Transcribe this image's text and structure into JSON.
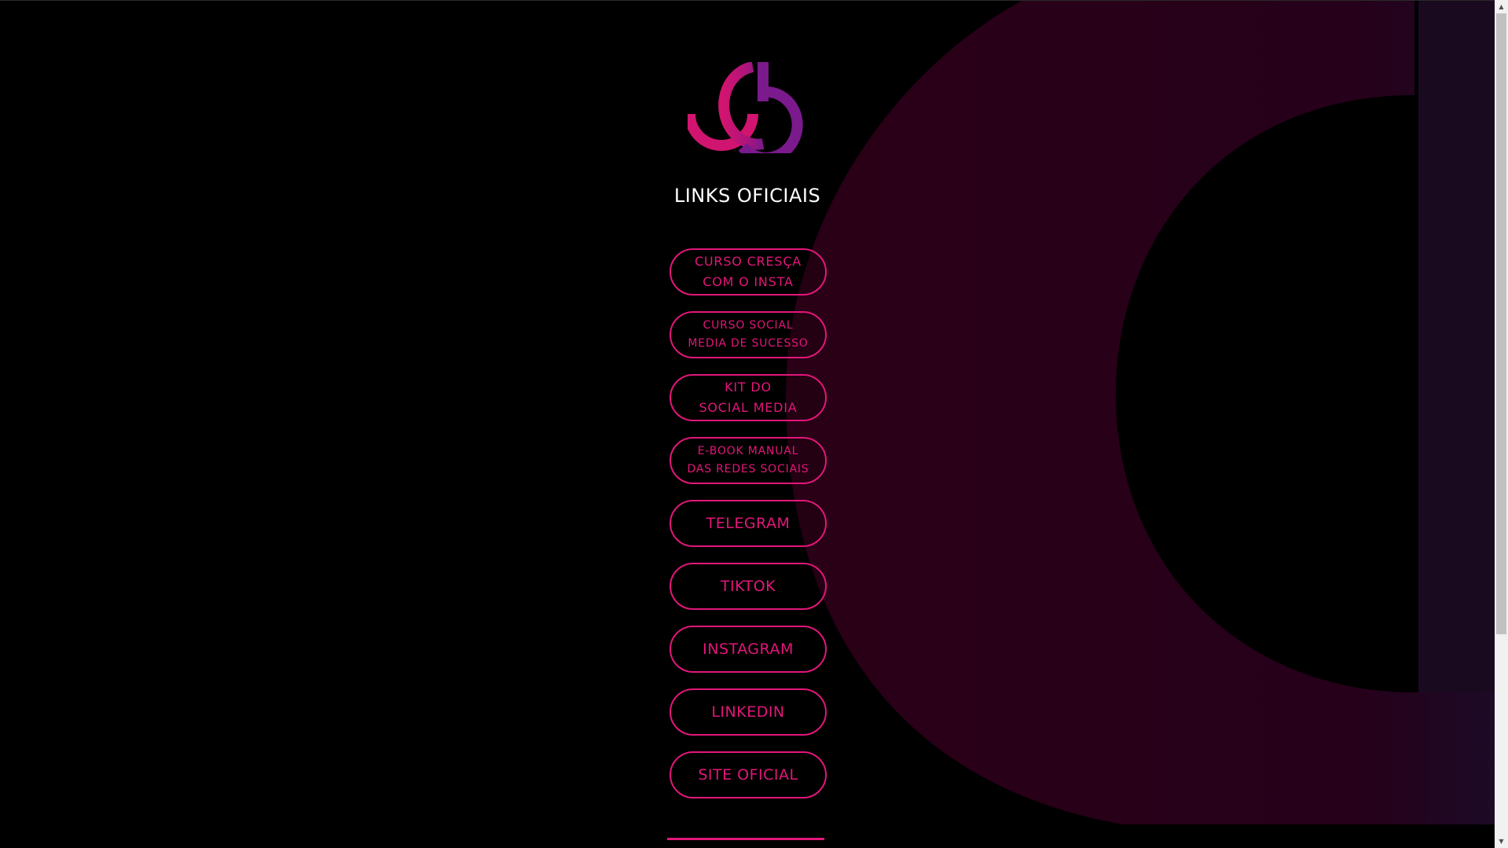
{
  "page": {
    "title": "LINKS OFICIAIS"
  },
  "links": [
    {
      "label": "CURSO CRESÇA\nCOM O INSTA",
      "size": "md"
    },
    {
      "label": "CURSO SOCIAL\nMEDIA DE SUCESSO",
      "size": "sm"
    },
    {
      "label": "KIT DO\nSOCIAL MEDIA",
      "size": "md"
    },
    {
      "label": "E-BOOK MANUAL\nDAS REDES SOCIAIS",
      "size": "sm"
    },
    {
      "label": "TELEGRAM",
      "size": "lg"
    },
    {
      "label": "TIKTOK",
      "size": "lg"
    },
    {
      "label": "INSTAGRAM",
      "size": "lg"
    },
    {
      "label": "LINKEDIN",
      "size": "lg"
    },
    {
      "label": "SITE OFICIAL",
      "size": "lg"
    }
  ],
  "colors": {
    "accent": "#e3167a",
    "background": "#000000",
    "title": "#ffffff",
    "logo_pink": "#d1146f",
    "logo_purple": "#7a1a8c",
    "bg_ring": "#2b0016"
  },
  "icons": {
    "logo": "brand-logo",
    "scroll_up": "scroll-up-arrow-icon",
    "scroll_down": "scroll-down-arrow-icon"
  }
}
